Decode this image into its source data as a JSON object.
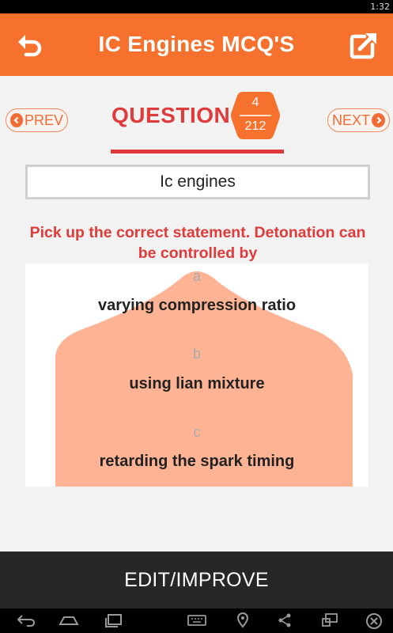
{
  "status_bar": {
    "time": "1:32"
  },
  "app_bar": {
    "title": "IC Engines MCQ'S",
    "back_icon": "undo-arrow-icon",
    "share_icon": "open-external-icon"
  },
  "navigation": {
    "prev_label": "PREV",
    "next_label": "NEXT",
    "question_label": "QUESTION",
    "current": "4",
    "total": "212"
  },
  "category": "Ic engines",
  "question_text": "Pick up the correct statement. Detonation can be controlled by",
  "options": [
    {
      "letter": "a",
      "text": "varying compression ratio"
    },
    {
      "letter": "b",
      "text": "using lian mixture"
    },
    {
      "letter": "c",
      "text": "retarding the spark timing"
    }
  ],
  "edit_button": "EDIT/IMPROVE",
  "colors": {
    "primary": "#f5712d",
    "accent_red": "#e03b3b",
    "option_highlight": "#fdb394",
    "bottom_bar": "#272727"
  }
}
